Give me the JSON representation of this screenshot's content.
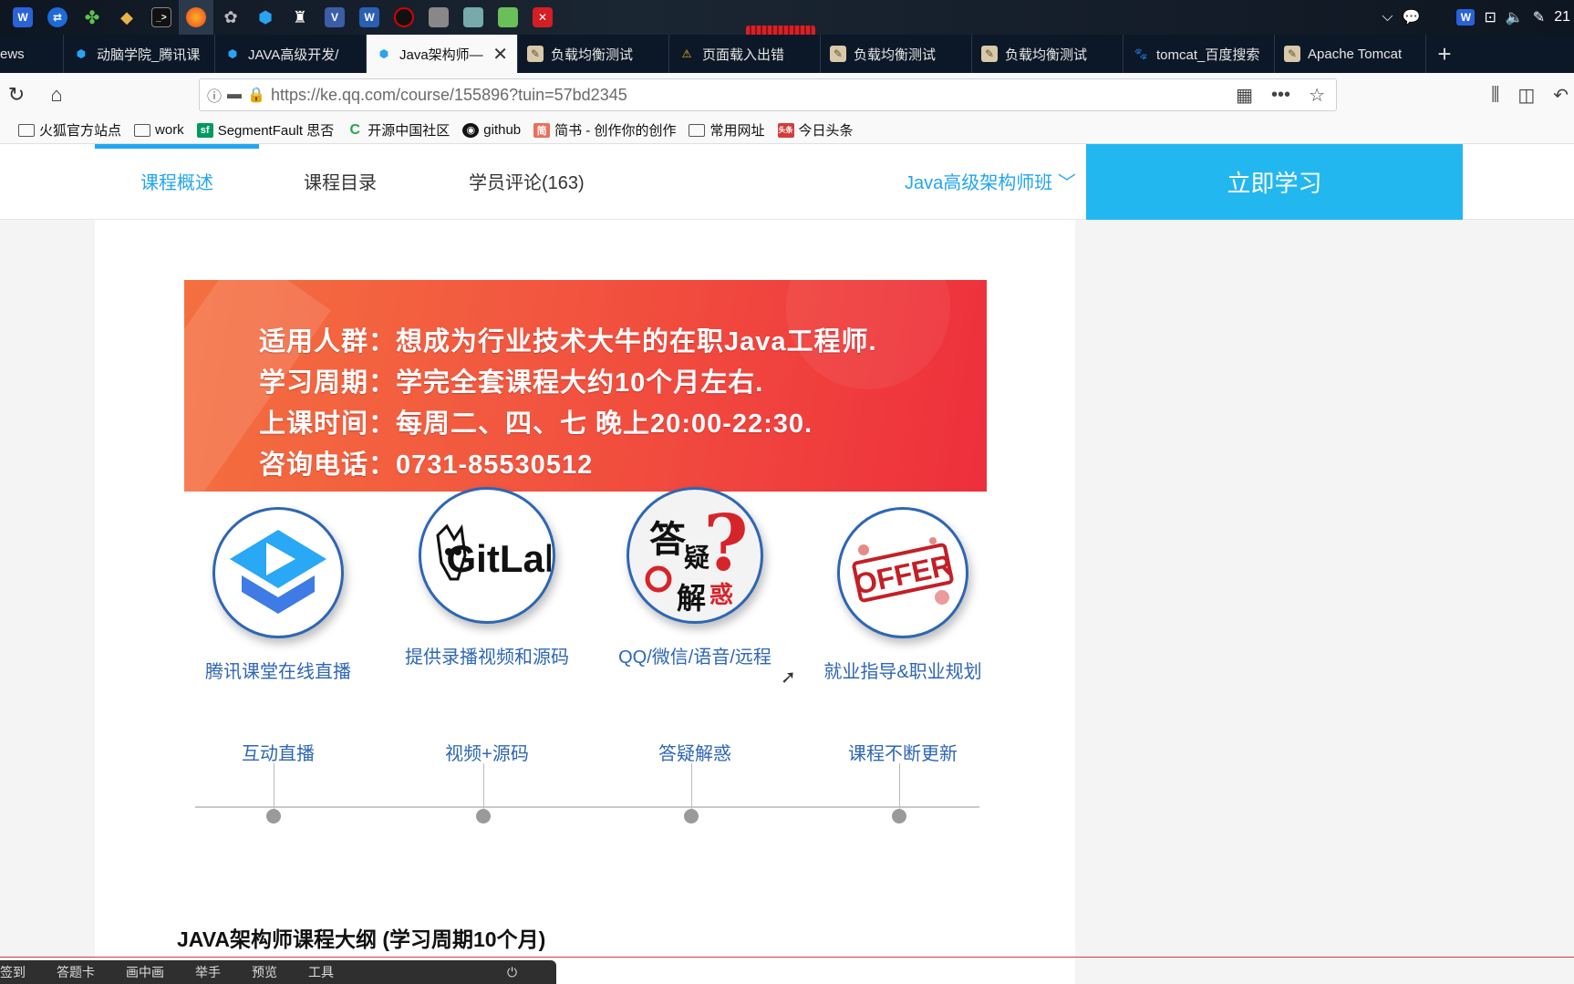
{
  "taskbar": {
    "icons": [
      "wps-w-icon",
      "teamviewer-icon",
      "clover-icon",
      "git-icon",
      "terminal-icon",
      "firefox-icon",
      "sticker-icon",
      "tencent-edu-icon",
      "qq-icon",
      "visio-icon",
      "word-icon",
      "recorder-icon",
      "window-icon",
      "picture-icon",
      "notepad-icon",
      "close-red-icon"
    ],
    "clock": "21"
  },
  "tabs": [
    {
      "label": "ews",
      "favicon": "none"
    },
    {
      "label": "动脑学院_腾讯课",
      "favicon": "tencent"
    },
    {
      "label": "JAVA高级开发/",
      "favicon": "tencent"
    },
    {
      "label": "Java架构师—",
      "favicon": "tencent",
      "active": true
    },
    {
      "label": "负载均衡测试",
      "favicon": "page"
    },
    {
      "label": "页面载入出错",
      "favicon": "warning"
    },
    {
      "label": "负载均衡测试",
      "favicon": "page"
    },
    {
      "label": "负载均衡测试",
      "favicon": "page"
    },
    {
      "label": "tomcat_百度搜索",
      "favicon": "baidu"
    },
    {
      "label": "Apache Tomcat",
      "favicon": "page"
    }
  ],
  "address": {
    "url": "https://ke.qq.com/course/155896?tuin=57bd2345"
  },
  "bookmarks": [
    {
      "label": "火狐官方站点",
      "icon": "folder"
    },
    {
      "label": "work",
      "icon": "folder"
    },
    {
      "label": "SegmentFault 思否",
      "icon": "sf"
    },
    {
      "label": "开源中国社区",
      "icon": "oschina"
    },
    {
      "label": "github",
      "icon": "github"
    },
    {
      "label": "简书 - 创作你的创作",
      "icon": "jianshu"
    },
    {
      "label": "常用网址",
      "icon": "folder"
    },
    {
      "label": "今日头条",
      "icon": "toutiao"
    }
  ],
  "subnav": {
    "overview": "课程概述",
    "catalog": "课程目录",
    "reviews": "学员评论(163)",
    "course_select": "Java高级架构师班",
    "study_button": "立即学习"
  },
  "banner": {
    "lines": [
      "适用人群：想成为行业技术大牛的在职Java工程师.",
      "学习周期：学完全套课程大约10个月左右.",
      "上课时间：每周二、四、七 晚上20:00-22:30.",
      "咨询电话：0731-85530512"
    ]
  },
  "features": [
    {
      "title": "腾讯课堂在线直播",
      "sub": "互动直播",
      "icon": "tencent-classroom-logo-icon"
    },
    {
      "title": "提供录播视频和源码",
      "sub": "视频+源码",
      "icon": "gitlab-logo-icon",
      "logo_text": "GitLab"
    },
    {
      "title": "QQ/微信/语音/远程",
      "sub": "答疑解惑",
      "icon": "qa-calligraphy-icon",
      "logo_text": "答疑解惑"
    },
    {
      "title": "就业指导&职业规划",
      "sub": "课程不断更新",
      "icon": "offer-stamp-icon",
      "logo_text": "OFFER"
    }
  ],
  "outline_title": "JAVA架构师课程大纲 (学习周期10个月)",
  "bottom_toolbar": [
    "签到",
    "答题卡",
    "画中画",
    "举手",
    "预览",
    "工具"
  ],
  "colors": {
    "accent": "#23a5f0",
    "study_button": "#23b7f0",
    "feature_blue": "#2e66b5",
    "banner_red": "#ee2f3c"
  }
}
